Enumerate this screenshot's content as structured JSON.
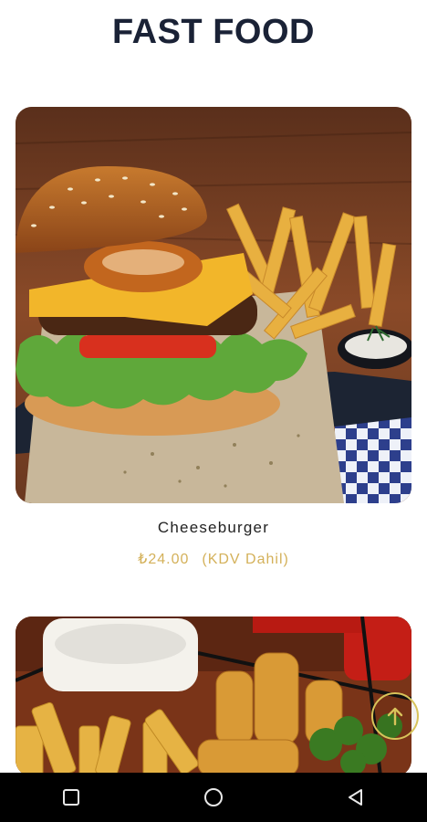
{
  "header": {
    "title": "FAST FOOD"
  },
  "menu": [
    {
      "name": "Cheeseburger",
      "price": "₺24.00",
      "tax_note": "(KDV Dahil)"
    }
  ],
  "colors": {
    "title": "#1a2236",
    "price": "#d4b15a",
    "navbar": "#000000"
  },
  "icons": [
    "arrow-up-icon",
    "recents-square-icon",
    "home-circle-icon",
    "back-triangle-icon"
  ]
}
